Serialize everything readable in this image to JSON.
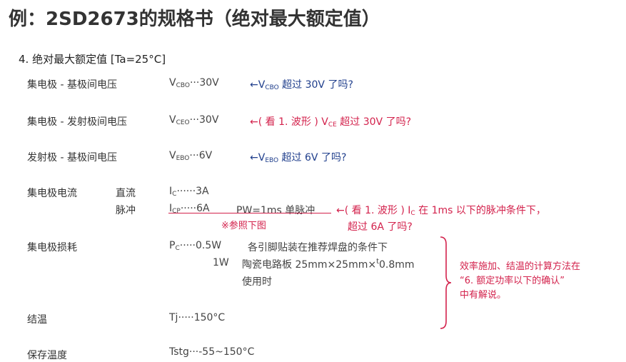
{
  "title": "例：2SD2673的规格书（绝对最大额定值）",
  "section": "4. 绝对最大额定值 [Ta=25°C]",
  "rows": {
    "vcbo": {
      "label": "集电极 - 基极间电压",
      "sym": "V",
      "sub": "CBO",
      "dots": "···",
      "value": "30V",
      "note_prefix": "←V",
      "note_sub": "CBO",
      "note_suffix": " 超过 30V 了吗?"
    },
    "vceo": {
      "label": "集电极 - 发射极间电压",
      "sym": "V",
      "sub": "CEO",
      "dots": "···",
      "value": "30V",
      "note_prefix": "←( 看 1. 波形 ) V",
      "note_sub": "CE",
      "note_suffix": " 超过 30V 了吗?"
    },
    "vebo": {
      "label": "发射极 - 基极间电压",
      "sym": "V",
      "sub": "EBO",
      "dots": "···",
      "value": "6V",
      "note_prefix": "←V",
      "note_sub": "EBO",
      "note_suffix": " 超过 6V 了吗?"
    },
    "ic": {
      "label": "集电极电流",
      "dc_label": "直流",
      "pulse_label": "脉冲",
      "dc_sym": "I",
      "dc_sub": "C",
      "dc_dots": "······",
      "dc_value": "3A",
      "pulse_sym": "I",
      "pulse_sub": "CP",
      "pulse_dots": "·····",
      "pulse_value": "6A",
      "pulse_cond": "PW=1ms 单脉冲",
      "ref": "※参照下图",
      "note_prefix": "←( 看 1. 波形 ) I",
      "note_sub": "C",
      "note_mid": " 在 1ms 以下的脉冲条件下，",
      "note_line2": "超过 6A 了吗?"
    },
    "pc": {
      "label": "集电极损耗",
      "sym": "P",
      "sub": "C",
      "dots": "·····",
      "value": "0.5W",
      "cond1": "各引脚贴装在推荐焊盘的条件下",
      "value2": "1W",
      "cond2_a": "陶瓷电路板 25mm×25mm×",
      "cond2_sup": "t",
      "cond2_b": "0.8mm",
      "cond2_line2": "使用时"
    },
    "tj": {
      "label": "结温",
      "value": "Tj·····150°C"
    },
    "tstg": {
      "label": "保存温度",
      "value": "Tstg···-55~150°C"
    }
  },
  "side_note": {
    "line1": "效率施加、结温的计算方法在",
    "line2": "“6. 额定功率以下的确认”",
    "line3": "中有解说。"
  },
  "colors": {
    "blue": "#1f3e8c",
    "red": "#d3224c",
    "text": "#333333"
  }
}
